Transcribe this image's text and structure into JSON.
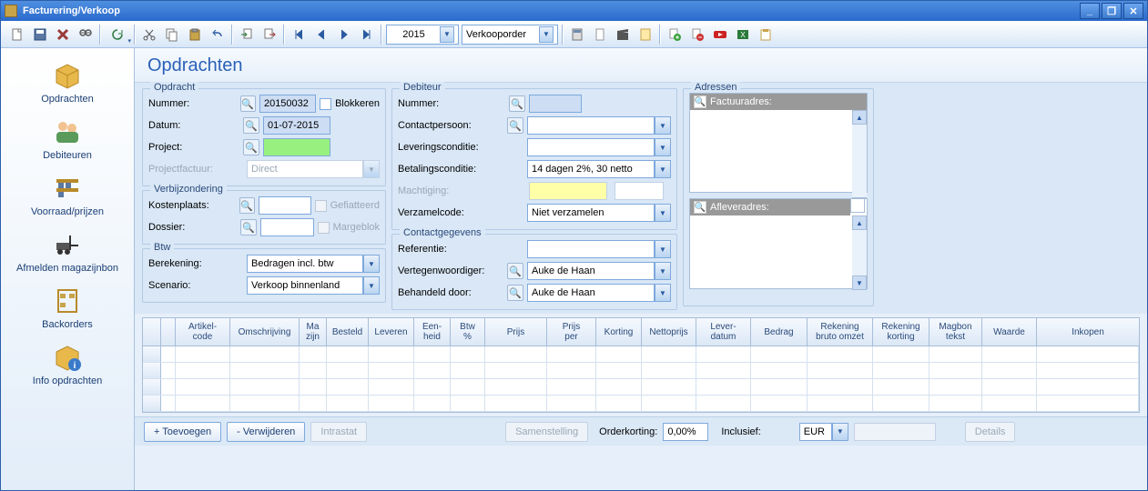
{
  "title": "Facturering/Verkoop",
  "toolbar": {
    "year": "2015",
    "ordertype": "Verkooporder"
  },
  "sidebar": {
    "items": [
      {
        "label": "Opdrachten"
      },
      {
        "label": "Debiteuren"
      },
      {
        "label": "Voorraad/prijzen"
      },
      {
        "label": "Afmelden magazijnbon"
      },
      {
        "label": "Backorders"
      },
      {
        "label": "Info opdrachten"
      }
    ]
  },
  "page": {
    "title": "Opdrachten"
  },
  "opdracht": {
    "legend": "Opdracht",
    "nummer_label": "Nummer:",
    "nummer": "20150032",
    "blokkeren": "Blokkeren",
    "datum_label": "Datum:",
    "datum": "01-07-2015",
    "project_label": "Project:",
    "project": "",
    "projectfactuur_label": "Projectfactuur:",
    "projectfactuur": "Direct"
  },
  "verb": {
    "legend": "Verbijzondering",
    "kostenplaats_label": "Kostenplaats:",
    "kostenplaats": "",
    "gefiatteerd": "Gefiatteerd",
    "dossier_label": "Dossier:",
    "dossier": "",
    "margeblok": "Margeblok"
  },
  "btw": {
    "legend": "Btw",
    "berekening_label": "Berekening:",
    "berekening": "Bedragen incl. btw",
    "scenario_label": "Scenario:",
    "scenario": "Verkoop binnenland"
  },
  "deb": {
    "legend": "Debiteur",
    "nummer_label": "Nummer:",
    "nummer": "",
    "contact_label": "Contactpersoon:",
    "contact": "",
    "levcond_label": "Leveringsconditie:",
    "levcond": "",
    "betcond_label": "Betalingsconditie:",
    "betcond": "14 dagen 2%, 30 netto",
    "macht_label": "Machtiging:",
    "macht": "",
    "verzamel_label": "Verzamelcode:",
    "verzamel": "Niet verzamelen"
  },
  "contact": {
    "legend": "Contactgegevens",
    "ref_label": "Referentie:",
    "ref": "",
    "vert_label": "Vertegenwoordiger:",
    "vert": "Auke de Haan",
    "beh_label": "Behandeld door:",
    "beh": "Auke de Haan"
  },
  "adres": {
    "legend": "Adressen",
    "factuur": "Factuuradres:",
    "aflever": "Afleveradres:"
  },
  "gridhead": [
    "",
    "",
    "Artikel-\ncode",
    "Omschrijving",
    "Ma\nzijn",
    "Besteld",
    "Leveren",
    "Een-\nheid",
    "Btw\n%",
    "Prijs",
    "Prijs\nper",
    "Korting",
    "Nettoprijs",
    "Lever-\ndatum",
    "Bedrag",
    "Rekening\nbruto omzet",
    "Rekening\nkorting",
    "Magbon\ntekst",
    "Waarde",
    "Inkopen"
  ],
  "foot": {
    "toevoegen": "+ Toevoegen",
    "verwijderen": "- Verwijderen",
    "intrastat": "Intrastat",
    "samen": "Samenstelling",
    "orderkorting_label": "Orderkorting:",
    "orderkorting": "0,00%",
    "inclusief": "Inclusief:",
    "currency": "EUR",
    "details": "Details"
  }
}
